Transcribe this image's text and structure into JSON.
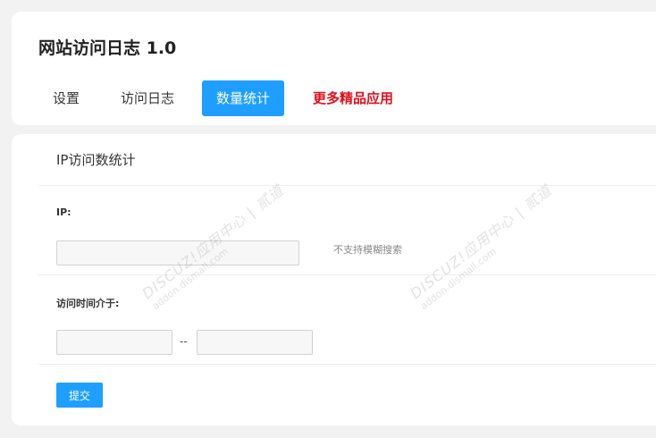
{
  "header": {
    "title": "网站访问日志 1.0",
    "tabs": [
      {
        "label": "设置"
      },
      {
        "label": "访问日志"
      },
      {
        "label": "数量统计",
        "active": true
      },
      {
        "label": "更多精品应用",
        "promo": true
      }
    ]
  },
  "form": {
    "section_title": "IP访问数统计",
    "ip_label": "IP:",
    "ip_value": "",
    "ip_hint": "不支持模糊搜索",
    "time_label": "访问时间介于:",
    "time_start": "",
    "time_end": "",
    "range_separator": "--",
    "submit_label": "提交"
  },
  "watermark": {
    "line1": "DISCUZ!应用中心 | 贰道",
    "line2": "addon.dismall.com"
  },
  "colors": {
    "accent": "#1e9fff",
    "promo": "#e0101c",
    "background": "#f2f2f2"
  }
}
